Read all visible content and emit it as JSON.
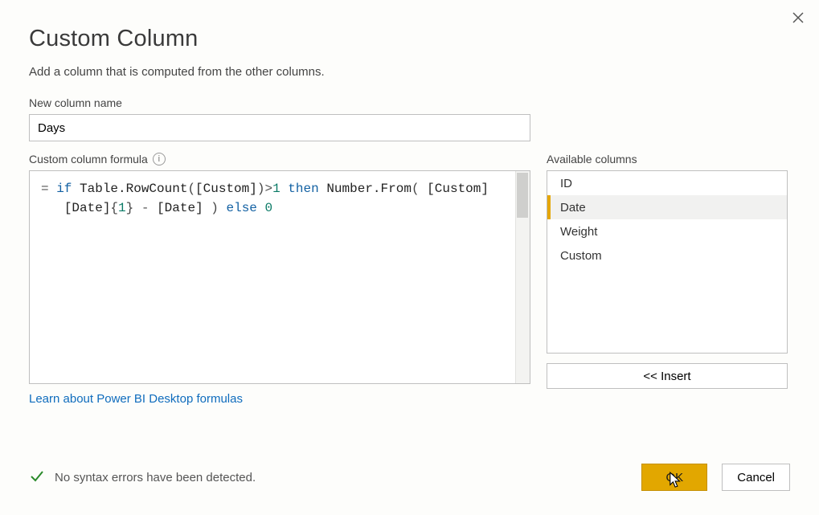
{
  "dialog": {
    "title": "Custom Column",
    "subtitle": "Add a column that is computed from the other columns.",
    "close_name": "close"
  },
  "name_field": {
    "label": "New column name",
    "value": "Days"
  },
  "formula_field": {
    "label": "Custom column formula",
    "info_tooltip": "i",
    "eq_prefix": "= ",
    "kw_if": "if",
    "fn_rowcount": "Table.RowCount",
    "open1": "(",
    "field_custom1": "[Custom]",
    "close1": ")",
    "gt": ">",
    "num1": "1",
    "kw_then": "then",
    "fn_numfrom": "Number.From",
    "open2": "(",
    "field_custom2": "[Custom]",
    "line2_indent": "   ",
    "field_date_idx": "[Date]",
    "brace_open": "{",
    "idx1": "1",
    "brace_close": "}",
    "minus": " - ",
    "field_date2": "[Date]",
    "close2": " )",
    "kw_else": "else",
    "num0": "0",
    "raw": "= if Table.RowCount([Custom])>1 then Number.From( [Custom]\n   [Date]{1} - [Date] ) else 0"
  },
  "available": {
    "label": "Available columns",
    "items": [
      {
        "label": "ID",
        "selected": false
      },
      {
        "label": "Date",
        "selected": true
      },
      {
        "label": "Weight",
        "selected": false
      },
      {
        "label": "Custom",
        "selected": false
      }
    ]
  },
  "insert_button": "<< Insert",
  "link_text": "Learn about Power BI Desktop formulas",
  "status_text": "No syntax errors have been detected.",
  "buttons": {
    "ok": "OK",
    "cancel": "Cancel"
  }
}
